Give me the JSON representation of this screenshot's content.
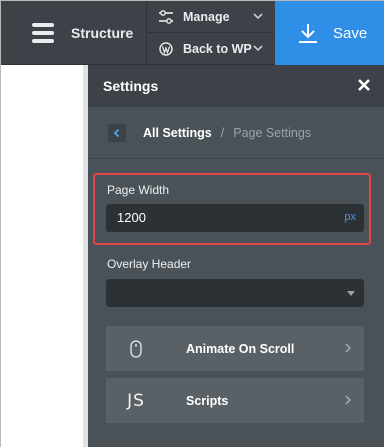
{
  "toolbar": {
    "structure_label": "Structure",
    "manage_label": "Manage",
    "back_label": "Back to WP",
    "save_label": "Save"
  },
  "settings_panel": {
    "title": "Settings",
    "breadcrumb": {
      "all_settings": "All Settings",
      "separator": "/",
      "current": "Page Settings"
    },
    "page_width": {
      "label": "Page Width",
      "value": "1200",
      "unit": "px"
    },
    "overlay_header": {
      "label": "Overlay Header",
      "value": ""
    },
    "rows": [
      {
        "label": "Animate On Scroll",
        "icon": "mouse-icon"
      },
      {
        "label": "Scripts",
        "icon_text": "JS"
      }
    ]
  },
  "colors": {
    "toolbar_bg": "#3c4247",
    "panel_bg": "#4a5257",
    "save_bg": "#2f8fe6",
    "highlight": "#e0454a",
    "unit_accent": "#5a90d3"
  }
}
